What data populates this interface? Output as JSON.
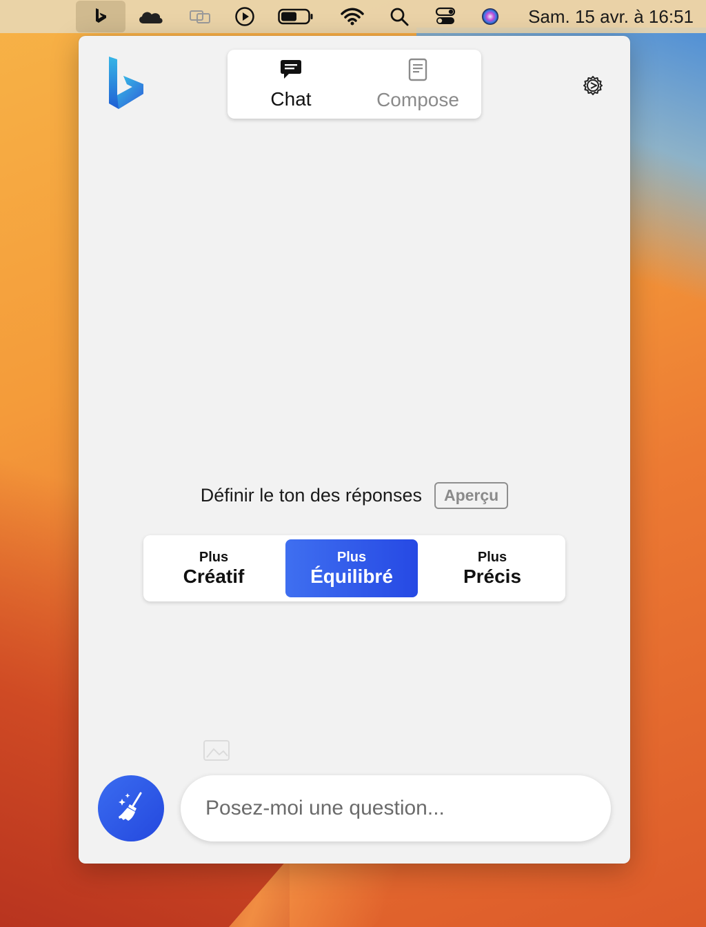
{
  "menubar": {
    "icons": [
      "bing-icon",
      "onedrive-icon",
      "screen-mirroring-icon",
      "media-play-icon",
      "battery-icon",
      "wifi-icon",
      "spotlight-search-icon",
      "control-center-icon",
      "siri-icon"
    ],
    "clock": "Sam. 15 avr. à 16:51"
  },
  "window": {
    "tabs": [
      {
        "label": "Chat",
        "icon": "chat-bubble-icon",
        "selected": true
      },
      {
        "label": "Compose",
        "icon": "document-icon",
        "selected": false
      }
    ],
    "settings_icon": "gear-icon"
  },
  "tone": {
    "label": "Définir le ton des réponses",
    "badge": "Aperçu",
    "modes": [
      {
        "small": "Plus",
        "big": "Créatif",
        "selected": false
      },
      {
        "small": "Plus",
        "big": "Équilibré",
        "selected": true
      },
      {
        "small": "Plus",
        "big": "Précis",
        "selected": false
      }
    ]
  },
  "composer": {
    "new_topic_icon": "broom-icon",
    "placeholder": "Posez-moi une question..."
  },
  "colors": {
    "accent": "#2f5ae8",
    "window_bg": "#f2f2f2"
  }
}
